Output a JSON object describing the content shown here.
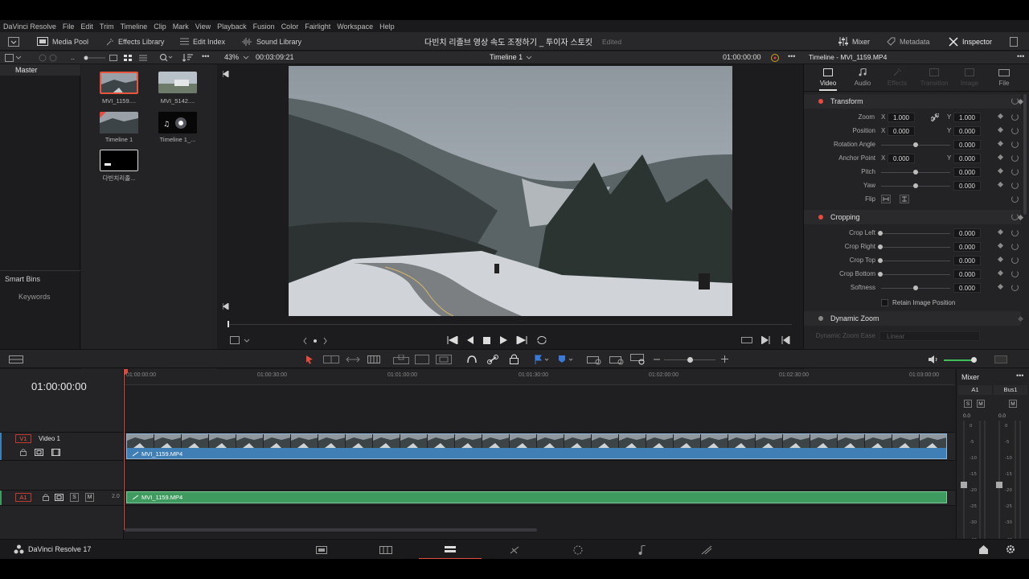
{
  "menu": [
    "DaVinci Resolve",
    "File",
    "Edit",
    "Trim",
    "Timeline",
    "Clip",
    "Mark",
    "View",
    "Playback",
    "Fusion",
    "Color",
    "Fairlight",
    "Workspace",
    "Help"
  ],
  "toolbar": {
    "media_pool": "Media Pool",
    "effects_library": "Effects Library",
    "edit_index": "Edit Index",
    "sound_library": "Sound Library",
    "project_title": "다빈치 리졸브 영상 속도 조정하기 _ 투이자 스토킷",
    "edited": "Edited",
    "mixer": "Mixer",
    "metadata": "Metadata",
    "inspector": "Inspector"
  },
  "viewer": {
    "zoom": "43%",
    "duration": "00:03:09:21",
    "timeline_name": "Timeline 1",
    "timecode": "01:00:00:00"
  },
  "bins": {
    "master": "Master",
    "smart_bins": "Smart Bins",
    "keywords": "Keywords"
  },
  "media": [
    {
      "label": "MVI_1159...."
    },
    {
      "label": "MVI_5142...."
    },
    {
      "label": "Timeline 1"
    },
    {
      "label": "Timeline 1_..."
    },
    {
      "label": "다빈치리졸..."
    }
  ],
  "inspector": {
    "title": "Timeline - MVI_1159.MP4",
    "tabs": [
      "Video",
      "Audio",
      "Effects",
      "Transition",
      "Image",
      "File"
    ],
    "transform": "Transform",
    "cropping": "Cropping",
    "dynamic_zoom": "Dynamic Zoom",
    "dynamic_zoom_ease": "Dynamic Zoom Ease",
    "dynamic_zoom_ease_value": "Linear",
    "retain_image_position": "Retain Image Position",
    "rows": {
      "zoom": {
        "label": "Zoom",
        "x": "1.000",
        "y": "1.000"
      },
      "position": {
        "label": "Position",
        "x": "0.000",
        "y": "0.000"
      },
      "rotation": {
        "label": "Rotation Angle",
        "value": "0.000"
      },
      "anchor": {
        "label": "Anchor Point",
        "x": "0.000",
        "y": "0.000"
      },
      "pitch": {
        "label": "Pitch",
        "value": "0.000"
      },
      "yaw": {
        "label": "Yaw",
        "value": "0.000"
      },
      "flip": {
        "label": "Flip"
      },
      "crop_left": {
        "label": "Crop Left",
        "value": "0.000"
      },
      "crop_right": {
        "label": "Crop Right",
        "value": "0.000"
      },
      "crop_top": {
        "label": "Crop Top",
        "value": "0.000"
      },
      "crop_bottom": {
        "label": "Crop Bottom",
        "value": "0.000"
      },
      "softness": {
        "label": "Softness",
        "value": "0.000"
      }
    },
    "axis_x": "X",
    "axis_y": "Y"
  },
  "timeline": {
    "timecode": "01:00:00:00",
    "ruler": [
      "01:00:00:00",
      "01:00:30:00",
      "01:01:00:00",
      "01:01:30:00",
      "01:02:00:00",
      "01:02:30:00",
      "01:03:00:00"
    ],
    "v1_label": "V1",
    "v1_name": "Video 1",
    "a1_label": "A1",
    "a1_channels": "2.0",
    "clip_name": "MVI_1159.MP4",
    "audio_clip_name": "MVI_1159.MP4",
    "solo": "S",
    "mute": "M"
  },
  "mixer": {
    "title": "Mixer",
    "a1": "A1",
    "bus1": "Bus1",
    "s": "S",
    "m": "M",
    "db_a1": "0.0",
    "db_bus": "0.0"
  },
  "footer": {
    "app_name": "DaVinci Resolve 17"
  },
  "colors": {
    "accent": "#e64b3c",
    "video_clip": "#3f7fb5",
    "audio_clip": "#3f9a5f",
    "playhead": "#e0483e"
  }
}
